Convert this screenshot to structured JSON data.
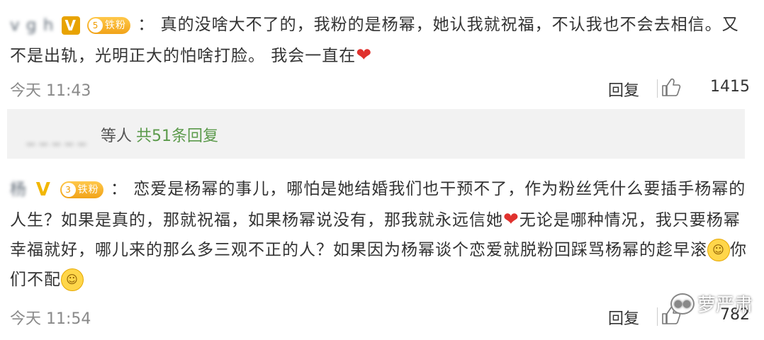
{
  "comments": [
    {
      "username": "v g  h  ",
      "badge_v": "V",
      "fan_badge": {
        "level": "5",
        "label": "铁粉"
      },
      "separator": "：",
      "text_part1": "真的没啥大不了的，我粉的是杨幂，她认我就祝福，不认我也不会去相信。又不是出轨，光明正大的怕啥打脸。 我会一直在",
      "emoji_after": "❤",
      "time": "今天 11:43",
      "reply_label": "回复",
      "likes": "1415"
    },
    {
      "username": "杨 ",
      "badge_v": "V",
      "fan_badge": {
        "level": "3",
        "label": "铁粉"
      },
      "separator": "：",
      "text_part1": "恋爱是杨幂的事儿，哪怕是她结婚我们也干预不了，作为粉丝凭什么要插手杨幂的人生？如果是真的，那就祝福，如果杨幂说没有，那我就永远信她",
      "emoji_heart": "❤",
      "text_part2": "无论是哪种情况，我只要杨幂幸福就好，哪儿来的那么多三观不正的人？如果因为杨幂谈个恋爱就脱粉回踩骂杨幂的趁早滚",
      "emoji_smile": "☺",
      "text_part3": "你们不配",
      "emoji_end": "☺",
      "time": "今天 11:54",
      "reply_label": "回复",
      "likes": "782"
    }
  ],
  "replies_box": {
    "names": "  _ _  _ _ _   ",
    "suffix": "等人",
    "more_link": "共51条回复"
  },
  "watermark": {
    "text": "萝严肃"
  },
  "icons": {
    "thumb": "thumbs-up-icon",
    "crown": "crown-icon",
    "wechat": "wechat-icon"
  },
  "colors": {
    "link_green": "#5b9a4b",
    "heart_red": "#e0322e",
    "badge_gold": "#f1a319"
  }
}
